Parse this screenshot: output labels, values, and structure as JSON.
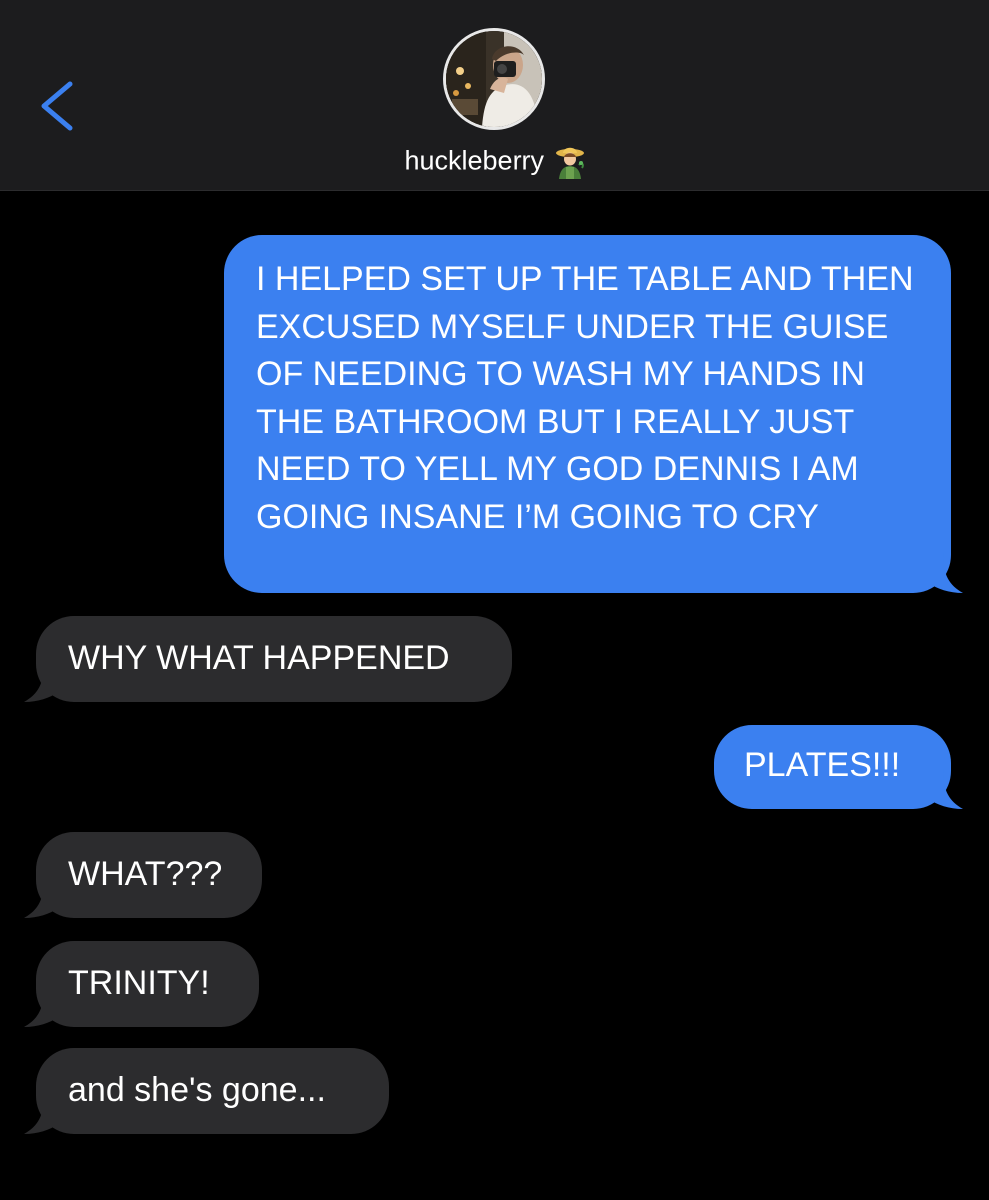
{
  "header": {
    "contact_name": "huckleberry",
    "icons": {
      "back": "chevron-left-icon",
      "avatar": "contact-avatar-photo",
      "name_emoji": "farmer-emoji-icon"
    },
    "colors": {
      "header_bg": "#1c1c1e",
      "back_accent": "#3b80f0"
    }
  },
  "messages": [
    {
      "direction": "sent",
      "text": "I HELPED SET UP THE TABLE AND THEN EXCUSED MYSELF UNDER THE GUISE OF NEEDING TO WASH MY HANDS IN THE BATHROOM BUT I REALLY JUST NEED TO YELL MY GOD DENNIS I AM GOING INSANE I’M GOING TO CRY"
    },
    {
      "direction": "received",
      "text": "WHY WHAT HAPPENED"
    },
    {
      "direction": "sent",
      "text": "PLATES!!!"
    },
    {
      "direction": "received",
      "text": "WHAT???"
    },
    {
      "direction": "received",
      "text": "TRINITY!"
    },
    {
      "direction": "received",
      "text": "and she's gone..."
    }
  ],
  "colors": {
    "background": "#000000",
    "sent_bubble": "#3b80f0",
    "received_bubble": "#2c2c2e",
    "text": "#ffffff"
  }
}
